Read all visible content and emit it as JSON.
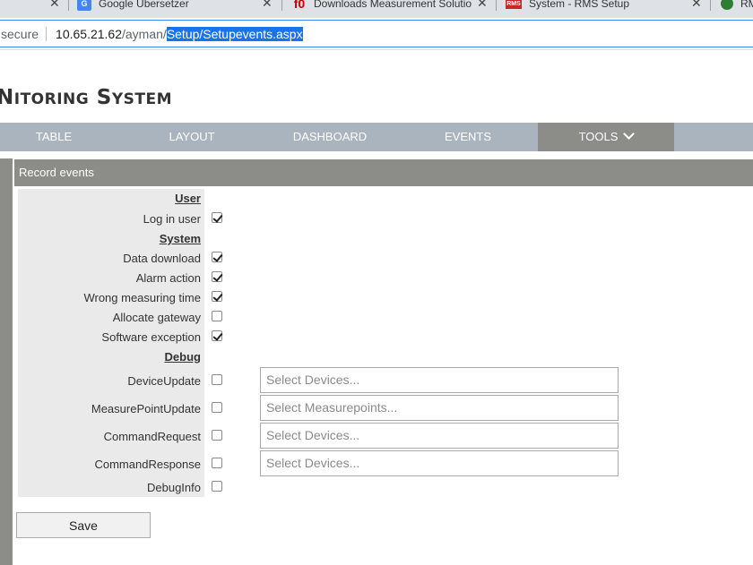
{
  "browser": {
    "tabs": [
      {
        "title": "Google Übersetzer"
      },
      {
        "title": "Downloads Measurement Solutio"
      },
      {
        "title": "System - RMS Setup"
      },
      {
        "title": "RM"
      }
    ],
    "address": {
      "security": "secure",
      "host": "10.65.21.62",
      "path_prefix": "/ayman/",
      "path_selected": "Setup/Setupevents.aspx"
    }
  },
  "header": {
    "brand_prefix": "NITORING ",
    "brand_suffix": "S",
    "brand_suffix_rest": "YSTEM"
  },
  "nav": {
    "items": [
      "TABLE",
      "LAYOUT",
      "DASHBOARD",
      "EVENTS"
    ],
    "tools": "TOOLS"
  },
  "panel": {
    "title": "Record events",
    "sections": {
      "user": "User",
      "system": "System",
      "debug": "Debug"
    },
    "user_events": [
      {
        "label": "Log in user",
        "checked": true
      }
    ],
    "system_events": [
      {
        "label": "Data download",
        "checked": true
      },
      {
        "label": "Alarm action",
        "checked": true
      },
      {
        "label": "Wrong measuring time",
        "checked": true
      },
      {
        "label": "Allocate gateway",
        "checked": false
      },
      {
        "label": "Software exception",
        "checked": true
      }
    ],
    "debug_events": [
      {
        "label": "DeviceUpdate",
        "checked": false,
        "placeholder": "Select Devices..."
      },
      {
        "label": "MeasurePointUpdate",
        "checked": false,
        "placeholder": "Select Measurepoints..."
      },
      {
        "label": "CommandRequest",
        "checked": false,
        "placeholder": "Select Devices..."
      },
      {
        "label": "CommandResponse",
        "checked": false,
        "placeholder": "Select Devices..."
      },
      {
        "label": "DebugInfo",
        "checked": false
      }
    ],
    "save_label": "Save"
  },
  "colors": {
    "nav_bg": "#a9b4bf",
    "panel_head_bg": "#8c8c88",
    "selection": "#1a73e8"
  }
}
